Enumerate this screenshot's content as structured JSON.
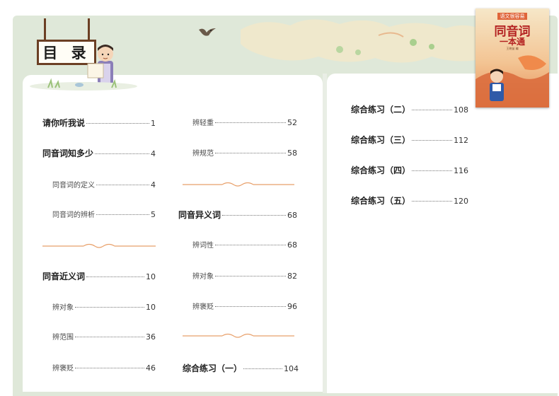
{
  "heading": {
    "text": "目 录"
  },
  "cover": {
    "tag": "语文很容易",
    "title": "同音词",
    "subtitle": "一本通",
    "author": "王晓苗 编"
  },
  "toc": {
    "left_column": [
      {
        "title": "请你听我说",
        "page": "1",
        "level": "major"
      },
      {
        "title": "同音词知多少",
        "page": "4",
        "level": "major"
      },
      {
        "title": "同音词的定义",
        "page": "4",
        "level": "minor"
      },
      {
        "title": "同音词的辨析",
        "page": "5",
        "level": "minor"
      },
      {
        "title": "同音近义词",
        "page": "10",
        "level": "major"
      },
      {
        "title": "辨对象",
        "page": "10",
        "level": "minor"
      },
      {
        "title": "辨范围",
        "page": "36",
        "level": "minor"
      },
      {
        "title": "辨褒贬",
        "page": "46",
        "level": "minor"
      }
    ],
    "middle_column": [
      {
        "title": "辨轻重",
        "page": "52",
        "level": "minor"
      },
      {
        "title": "辨规范",
        "page": "58",
        "level": "minor"
      },
      {
        "title": "同音异义词",
        "page": "68",
        "level": "major"
      },
      {
        "title": "辨词性",
        "page": "68",
        "level": "minor"
      },
      {
        "title": "辨对象",
        "page": "82",
        "level": "minor"
      },
      {
        "title": "辨褒贬",
        "page": "96",
        "level": "minor"
      },
      {
        "title": "综合练习（一）",
        "page": "104",
        "level": "major"
      }
    ],
    "right_column": [
      {
        "title": "综合练习（二）",
        "page": "108",
        "level": "major"
      },
      {
        "title": "综合练习（三）",
        "page": "112",
        "level": "major"
      },
      {
        "title": "综合练习（四）",
        "page": "116",
        "level": "major"
      },
      {
        "title": "综合练习（五）",
        "page": "120",
        "level": "major"
      }
    ]
  },
  "colors": {
    "background_green": "#dfe8d9",
    "divider_orange": "#e8a06a",
    "sign_frame": "#6b3f24",
    "cover_title_red": "#b32020"
  }
}
